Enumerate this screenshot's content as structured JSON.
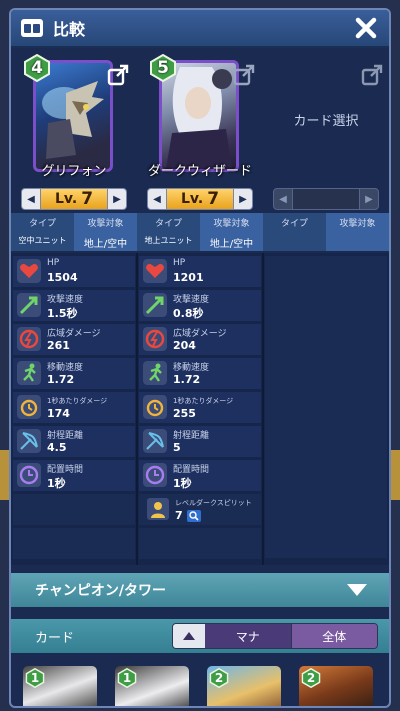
{
  "window": {
    "title": "比較",
    "title_icon": "compare-cards-icon",
    "close_icon": "close-icon"
  },
  "cards": [
    {
      "name": "グリフォン",
      "cost": "4",
      "level_prefix": "Lv.",
      "level": "7",
      "type_header": "タイプ",
      "type_value": "空中ユニット",
      "target_header": "攻撃対象",
      "target_value": "地上/空中",
      "frame_color": "#7a4fc9"
    },
    {
      "name": "ダークウィザード",
      "cost": "5",
      "level_prefix": "Lv.",
      "level": "7",
      "type_header": "タイプ",
      "type_value": "地上ユニット",
      "target_header": "攻撃対象",
      "target_value": "地上/空中",
      "frame_color": "#7a4fc9"
    },
    {
      "select_label": "カード選択",
      "type_header": "タイプ",
      "target_header": "攻撃対象"
    }
  ],
  "stats": {
    "labels": {
      "hp": "HP",
      "attack_speed": "攻撃速度",
      "area_damage": "広域ダメージ",
      "move_speed": "移動速度",
      "dps": "1秒あたりダメージ",
      "range": "射程距離",
      "deploy_time": "配置時間"
    },
    "col0": {
      "hp": "1504",
      "attack_speed": "1.5秒",
      "area_damage": "261",
      "move_speed": "1.72",
      "dps": "174",
      "range": "4.5",
      "deploy_time": "1秒"
    },
    "col1": {
      "hp": "1201",
      "attack_speed": "0.8秒",
      "area_damage": "204",
      "move_speed": "1.72",
      "dps": "255",
      "range": "5",
      "deploy_time": "1秒",
      "spirit_label": "レベルダークスピリット",
      "spirit_value": "7"
    }
  },
  "champion_bar": {
    "label": "チャンピオン/タワー"
  },
  "card_bar": {
    "label": "カード",
    "sort_mana": "マナ",
    "sort_all": "全体"
  },
  "hand": [
    {
      "cost": "1"
    },
    {
      "cost": "1"
    },
    {
      "cost": "2"
    },
    {
      "cost": "2"
    }
  ],
  "colors": {
    "accent": "#3a61a0",
    "level_gold": "#e9a21d",
    "cost_green": "#3f9d46"
  }
}
